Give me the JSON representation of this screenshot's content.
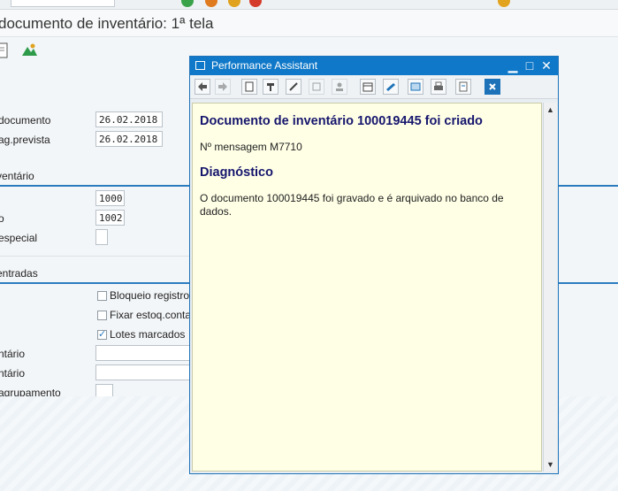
{
  "title": "documento de inventário: 1ª tela",
  "fields": {
    "data_documento_label": "documento",
    "data_documento_value": "26.02.2018",
    "data_prevista_label": "ag.prevista",
    "data_prevista_value": "26.02.2018",
    "inventario_group": "ventário",
    "centro_value": "1000",
    "deposito_label": "o",
    "deposito_value": "1002",
    "estoque_especial_label": "especial",
    "entradas_group": "entradas",
    "bloqueio_label": "Bloqueio registro",
    "fixar_label": "Fixar estoq.conta",
    "lotes_label": "Lotes marcados",
    "lotes_checked": "✓",
    "inventario_ref_label": "ntário",
    "inventario_ref2_label": "ntário",
    "agrupamento_label": "agrupamento"
  },
  "popup": {
    "title": "Performance Assistant",
    "heading": "Documento de inventário 100019445 foi criado",
    "message_no": "Nº mensagem M7710",
    "diag_heading": "Diagnóstico",
    "diag_text": "O documento 100019445 foi gravado e é arquivado no banco de dados.",
    "tools": [
      "back-icon",
      "forward-icon",
      "document-icon",
      "technical-info-icon",
      "edit-icon",
      "glossary-icon",
      "user-settings-icon",
      "calendar-icon",
      "highlight-icon",
      "window-icon",
      "print-icon",
      "print-preview-icon",
      "close-icon"
    ]
  },
  "colors": {
    "accent": "#0f78c8",
    "popup_bg": "#ffffe6",
    "heading": "#16166e"
  }
}
